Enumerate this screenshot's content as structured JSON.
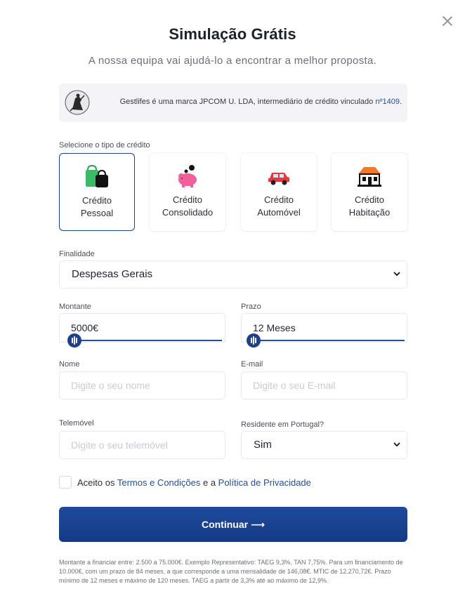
{
  "modal": {
    "title": "Simulação Grátis",
    "subtitle": "A nossa equipa vai ajudá-lo a encontrar a melhor proposta."
  },
  "notice": {
    "text": "Gestlifes é uma marca JPCOM U. LDA, intermediário de crédito vinculado ",
    "link": "nº1409",
    "suffix": "."
  },
  "credit_type": {
    "label": "Selecione o tipo de crédito",
    "options": [
      {
        "line1": "Crédito",
        "line2": "Pessoal",
        "icon": "shopping-bags-icon",
        "selected": true
      },
      {
        "line1": "Crédito",
        "line2": "Consolidado",
        "icon": "piggy-bank-icon",
        "selected": false
      },
      {
        "line1": "Crédito",
        "line2": "Automóvel",
        "icon": "car-icon",
        "selected": false
      },
      {
        "line1": "Crédito",
        "line2": "Habitação",
        "icon": "house-icon",
        "selected": false
      }
    ]
  },
  "finalidade": {
    "label": "Finalidade",
    "value": "Despesas Gerais"
  },
  "montante": {
    "label": "Montante",
    "value": "5000€",
    "slider_fraction": 0.03
  },
  "prazo": {
    "label": "Prazo",
    "value": "12 Meses",
    "slider_fraction": 0.0
  },
  "nome": {
    "label": "Nome",
    "placeholder": "Digite o seu nome"
  },
  "email": {
    "label": "E-mail",
    "placeholder": "Digite o seu E-mail"
  },
  "telemovel": {
    "label": "Telemóvel",
    "placeholder": "Digite o seu telemóvel"
  },
  "residente": {
    "label": "Residente em Portugal?",
    "value": "Sim"
  },
  "terms": {
    "prefix": "Aceito os ",
    "terms_link": "Termos e Condições",
    "middle": " e a ",
    "privacy_link": "Política de Privacidade"
  },
  "continue_label": "Continuar ⟶",
  "disclaimer": "Montante a financiar entre: 2.500 a 75.000€. Exemplo Representativo: TAEG 9,3%. TAN 7,75%. Para um financiamento de 10.000€, com um prazo de 84 meses, a que corresponde a uma mensalidade de 146,08€. MTIC de 12.270,72€. Prazo mínimo de 12 meses e máximo de 120 meses. TAEG a partir de 3,3% até ao máximo de 12,9%.",
  "colors": {
    "primary": "#1e3f8a",
    "link": "#1e4fa8",
    "notice_bg": "#f3f3f8"
  }
}
